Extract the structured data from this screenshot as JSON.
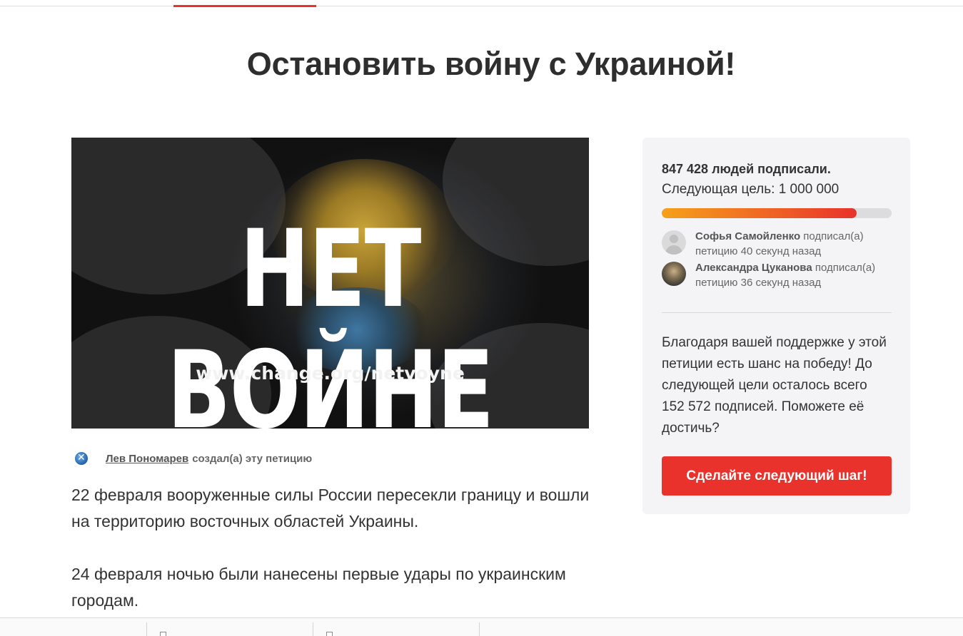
{
  "page": {
    "title": "Остановить войну с Украиной!"
  },
  "hero": {
    "headline": "НЕТ ВОЙНЕ",
    "url": "www.change.org/netvoyne"
  },
  "author": {
    "name": "Лев Пономарев",
    "created_text": "создал(а) эту петицию"
  },
  "body": {
    "paragraphs": [
      "22 февраля вооруженные силы России пересекли границу и вошли на территорию восточных областей Украины.",
      "24 февраля ночью были нанесены первые удары по украинским городам."
    ]
  },
  "sidebar": {
    "signed_count": "847 428 людей подписали.",
    "next_goal": "Следующая цель: 1 000 000",
    "progress_fraction": 0.847,
    "progress_colors": [
      "#f5a11a",
      "#e8322b"
    ],
    "signers": [
      {
        "name": "Софья Самойленко",
        "action": "подписал(а)",
        "time": "петицию 40 секунд назад",
        "avatar": "default-avatar-icon"
      },
      {
        "name": "Александра Цуканова",
        "action": "подписал(а)",
        "time": "петицию 36 секунд назад",
        "avatar": "user-photo"
      }
    ],
    "pitch": "Благодаря вашей поддержке у этой петиции есть шанс на победу! До следующей цели осталось всего 152 572 подписей. Поможете её достичь?",
    "cta_label": "Сделайте следующий шаг!"
  },
  "colors": {
    "accent": "#e8322b",
    "card_bg": "#f4f3f5",
    "text": "#333333"
  }
}
